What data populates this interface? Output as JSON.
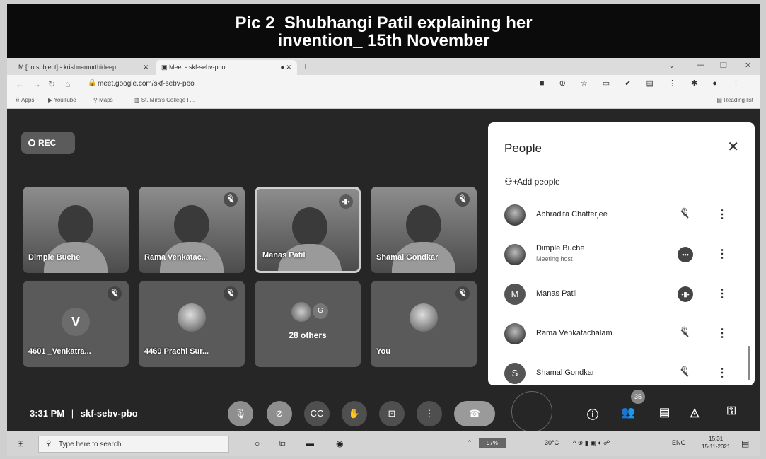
{
  "caption": {
    "line1": "Pic 2_Shubhangi Patil explaining her",
    "line2": "invention_ 15th November"
  },
  "browser": {
    "tabs": [
      {
        "label": "[no subject] - krishnamurthideep",
        "icon": "gmail-icon"
      },
      {
        "label": "Meet - skf-sebv-pbo",
        "icon": "meet-icon"
      }
    ],
    "url": "meet.google.com/skf-sebv-pbo",
    "bookmarks": [
      "Apps",
      "YouTube",
      "Maps",
      "St. Mira's College F..."
    ],
    "reading_list": "Reading list"
  },
  "meet": {
    "rec_label": "REC",
    "tiles": [
      {
        "name": "Dimple Buche",
        "type": "video",
        "muted": false
      },
      {
        "name": "Rama Venkatac...",
        "type": "video",
        "muted": true
      },
      {
        "name": "Manas Patil",
        "type": "video",
        "speaking": true
      },
      {
        "name": "Shamal Gondkar",
        "type": "video",
        "muted": true
      },
      {
        "name": "4601 _Venkatra...",
        "type": "avatar",
        "initial": "V",
        "muted": true
      },
      {
        "name": "4469 Prachi Sur...",
        "type": "photo",
        "muted": true
      },
      {
        "name": "28 others",
        "type": "others",
        "initial": "G"
      },
      {
        "name": "You",
        "type": "photo",
        "muted": true
      }
    ],
    "meeting_time": "3:31 PM",
    "separator": "|",
    "meeting_code": "skf-sebv-pbo",
    "participants_badge": "35"
  },
  "people_panel": {
    "title": "People",
    "add_people": "Add people",
    "participants": [
      {
        "name": "Abhradita Chatterjee",
        "avatar": "photo",
        "status": "muted"
      },
      {
        "name": "Dimple Buche",
        "sub": "Meeting host",
        "avatar": "photo",
        "status": "talking"
      },
      {
        "name": "Manas Patil",
        "avatar": "M",
        "status": "talking"
      },
      {
        "name": "Rama Venkatachalam",
        "avatar": "photo",
        "status": "muted"
      },
      {
        "name": "Shamal Gondkar",
        "avatar": "S",
        "status": "muted"
      }
    ]
  },
  "taskbar": {
    "search_placeholder": "Type here to search",
    "battery": "97%",
    "temperature": "30°C",
    "language": "ENG",
    "time": "15:31",
    "date": "15-11-2021"
  }
}
